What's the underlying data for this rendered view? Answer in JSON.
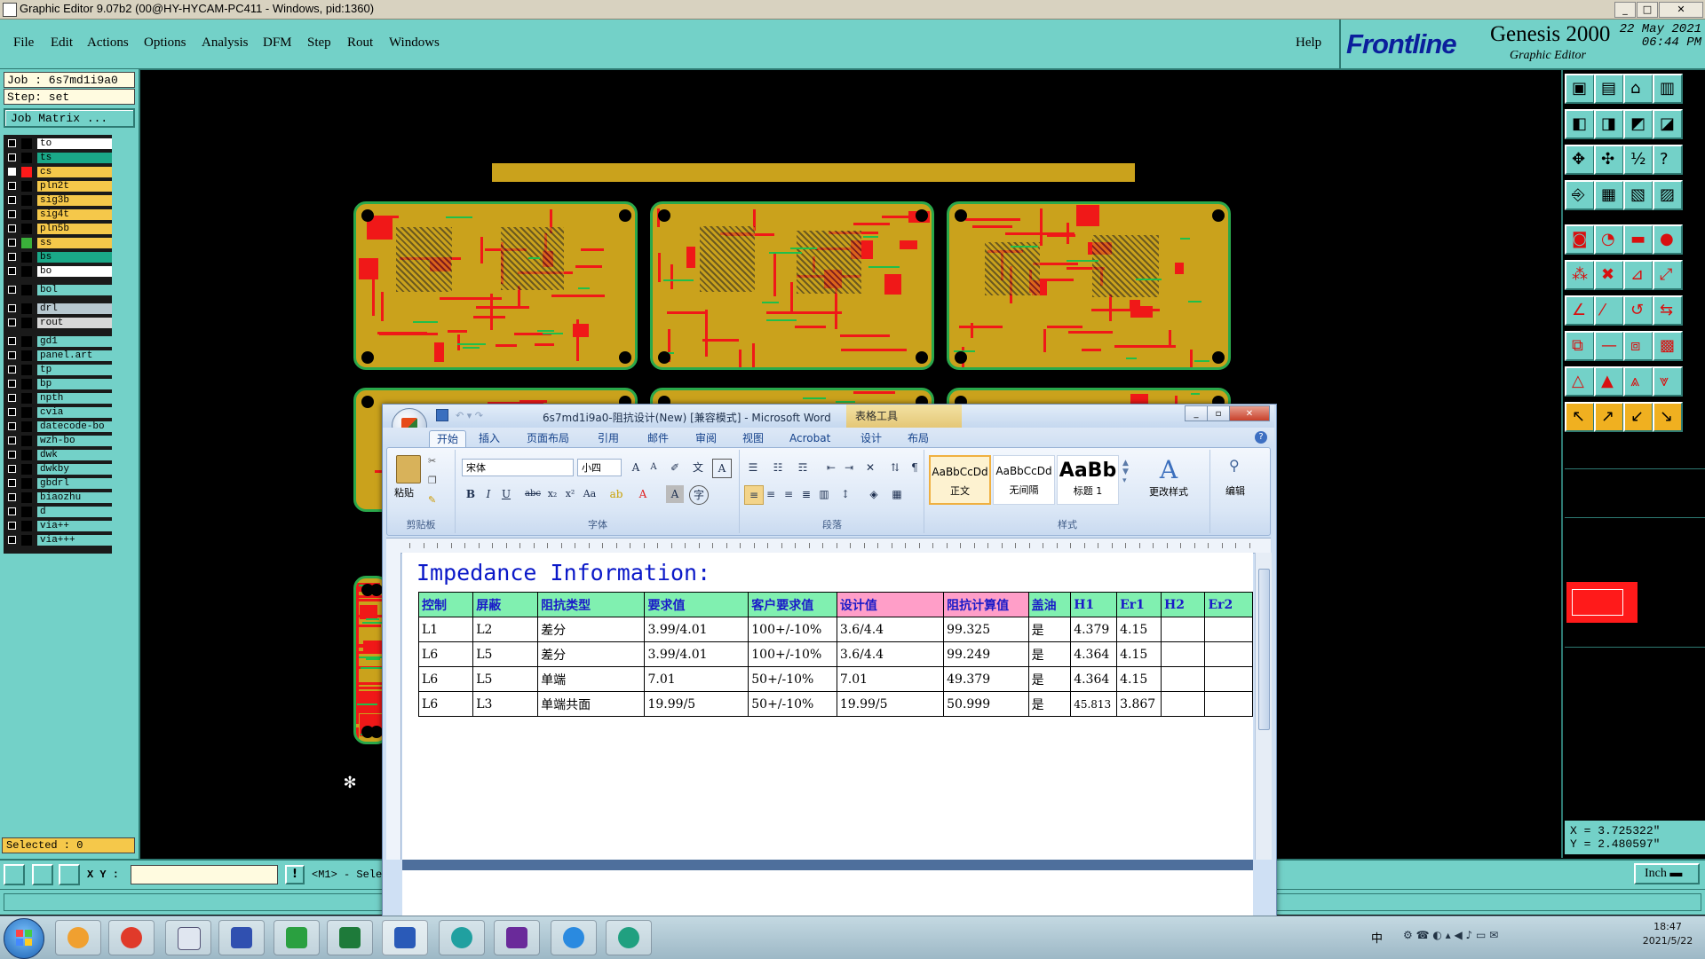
{
  "app": {
    "title": "Graphic Editor 9.07b2 (00@HY-HYCAM-PC411 - Windows, pid:1360)",
    "window_buttons": [
      "_",
      "□",
      "✕"
    ]
  },
  "menu": [
    "File",
    "Edit",
    "Actions",
    "Options",
    "Analysis",
    "DFM",
    "Step",
    "Rout",
    "Windows"
  ],
  "help": "Help",
  "brand": {
    "logo": "Frontline",
    "product": "Genesis 2000",
    "subtitle": "Graphic Editor",
    "date": "22 May 2021",
    "time": "06:44 PM"
  },
  "job": {
    "job_line": "Job : 6s7md1i9a0",
    "step_line": "Step: set",
    "matrix_button": "Job Matrix ..."
  },
  "layers": [
    {
      "name": "to",
      "color": "#ffffff",
      "swatch": "#000000",
      "checked": false
    },
    {
      "name": "ts",
      "color": "#1aa888",
      "swatch": "#000000",
      "checked": false
    },
    {
      "name": "cs",
      "color": "#f5c84a",
      "swatch": "#ff1a1a",
      "checked": true
    },
    {
      "name": "pln2t",
      "color": "#f5c84a",
      "swatch": "#000000",
      "checked": false
    },
    {
      "name": "sig3b",
      "color": "#f5c84a",
      "swatch": "#000000",
      "checked": false
    },
    {
      "name": "sig4t",
      "color": "#f5c84a",
      "swatch": "#000000",
      "checked": false
    },
    {
      "name": "pln5b",
      "color": "#f5c84a",
      "swatch": "#000000",
      "checked": false
    },
    {
      "name": "ss",
      "color": "#f5c84a",
      "swatch": "#3ab03a",
      "checked": false
    },
    {
      "name": "bs",
      "color": "#1aa888",
      "swatch": "#000000",
      "checked": false
    },
    {
      "name": "bo",
      "color": "#ffffff",
      "swatch": "#000000",
      "checked": false
    },
    {
      "name": "bol",
      "color": "#73d1c8",
      "swatch": "#000000",
      "checked": false,
      "gap": true
    },
    {
      "name": "drl",
      "color": "#b8c8d0",
      "swatch": "#000000",
      "checked": false,
      "gap": true
    },
    {
      "name": "rout",
      "color": "#d8d8d8",
      "swatch": "#000000",
      "checked": false
    },
    {
      "name": "gd1",
      "color": "#73d1c8",
      "swatch": "#000000",
      "checked": false,
      "gap": true
    },
    {
      "name": "panel.art",
      "color": "#73d1c8",
      "swatch": "#000000",
      "checked": false
    },
    {
      "name": "tp",
      "color": "#73d1c8",
      "swatch": "#000000",
      "checked": false
    },
    {
      "name": "bp",
      "color": "#73d1c8",
      "swatch": "#000000",
      "checked": false
    },
    {
      "name": "npth",
      "color": "#73d1c8",
      "swatch": "#000000",
      "checked": false
    },
    {
      "name": "cvia",
      "color": "#73d1c8",
      "swatch": "#000000",
      "checked": false
    },
    {
      "name": "datecode-bo",
      "color": "#73d1c8",
      "swatch": "#000000",
      "checked": false
    },
    {
      "name": "wzh-bo",
      "color": "#73d1c8",
      "swatch": "#000000",
      "checked": false
    },
    {
      "name": "dwk",
      "color": "#73d1c8",
      "swatch": "#000000",
      "checked": false
    },
    {
      "name": "dwkby",
      "color": "#73d1c8",
      "swatch": "#000000",
      "checked": false
    },
    {
      "name": "gbdrl",
      "color": "#73d1c8",
      "swatch": "#000000",
      "checked": false
    },
    {
      "name": "biaozhu",
      "color": "#73d1c8",
      "swatch": "#000000",
      "checked": false
    },
    {
      "name": "d",
      "color": "#73d1c8",
      "swatch": "#000000",
      "checked": false
    },
    {
      "name": "via++",
      "color": "#73d1c8",
      "swatch": "#000000",
      "checked": false
    },
    {
      "name": "via+++",
      "color": "#73d1c8",
      "swatch": "#000000",
      "checked": false
    }
  ],
  "selected": "Selected : 0",
  "coords": {
    "x": "X = 3.725322\"",
    "y": "Y = 2.480597\""
  },
  "status": {
    "xy_label": "X Y :",
    "xy_value": "",
    "message": "<M1> - Sele",
    "units": "Inch"
  },
  "word": {
    "title": "6s7md1i9a0-阻抗设计(New) [兼容模式] - Microsoft Word",
    "context_tab": "表格工具",
    "tabs": [
      "开始",
      "插入",
      "页面布局",
      "引用",
      "邮件",
      "审阅",
      "视图",
      "Acrobat",
      "设计",
      "布局"
    ],
    "font_name": "宋体",
    "font_size": "小四",
    "paste": "粘贴",
    "groups": [
      "剪贴板",
      "字体",
      "段落",
      "样式",
      "编辑"
    ],
    "styles": [
      {
        "preview": "AaBbCcDd",
        "name": "正文"
      },
      {
        "preview": "AaBbCcDd",
        "name": "无间隔"
      },
      {
        "preview": "AaBb",
        "name": "标题 1"
      }
    ],
    "change_styles": "更改样式",
    "edit": "编辑",
    "doc_title": "Impedance Information:",
    "table": {
      "headers": [
        "控制",
        "屏蔽",
        "阻抗类型",
        "要求值",
        "客户要求值",
        "设计值",
        "阻抗计算值",
        "盖油",
        "H1",
        "Er1",
        "H2",
        "Er2"
      ],
      "rows": [
        [
          "L1",
          "L2",
          "差分",
          "3.99/4.01",
          "100+/-10%",
          "3.6/4.4",
          "99.325",
          "是",
          "4.379",
          "4.15",
          "",
          ""
        ],
        [
          "L6",
          "L5",
          "差分",
          "3.99/4.01",
          "100+/-10%",
          "3.6/4.4",
          "99.249",
          "是",
          "4.364",
          "4.15",
          "",
          ""
        ],
        [
          "L6",
          "L5",
          "单端",
          "7.01",
          "50+/-10%",
          "7.01",
          "49.379",
          "是",
          "4.364",
          "4.15",
          "",
          ""
        ],
        [
          "L6",
          "L3",
          "单端共面",
          "19.99/5",
          "50+/-10%",
          "19.99/5",
          "50.999",
          "是",
          "45.813",
          "3.867",
          "",
          ""
        ]
      ]
    }
  },
  "taskbar": {
    "time": "18:47",
    "date": "2021/5/22",
    "ime": "中"
  }
}
